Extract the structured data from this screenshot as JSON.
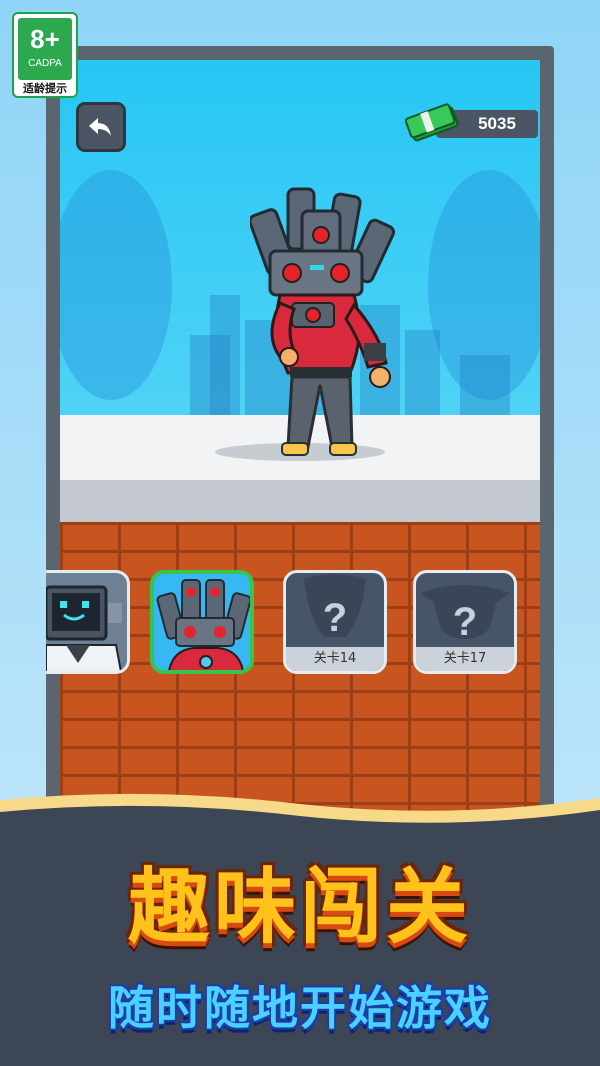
{
  "age_rating": {
    "number": "8+",
    "org": "CADPA",
    "tip": "适龄提示"
  },
  "header": {
    "back_icon": "back-arrow-icon",
    "currency_icon": "cash-stack-icon",
    "currency_value": "5035"
  },
  "characters": [
    {
      "name": "tv-man-card",
      "label": "",
      "state": "unlocked"
    },
    {
      "name": "speaker-man-card",
      "label": "",
      "state": "selected"
    },
    {
      "name": "locked-card-1",
      "label": "关卡14",
      "state": "locked"
    },
    {
      "name": "locked-card-2",
      "label": "关卡17",
      "state": "locked"
    }
  ],
  "banner": {
    "title": "趣味闯关",
    "subtitle": "随时随地开始游戏"
  },
  "colors": {
    "sky": "#27c6f4",
    "brick": "#c8541f",
    "selected_border": "#38c34a",
    "title": "#ffc21a",
    "subtitle": "#4ad1ff"
  }
}
